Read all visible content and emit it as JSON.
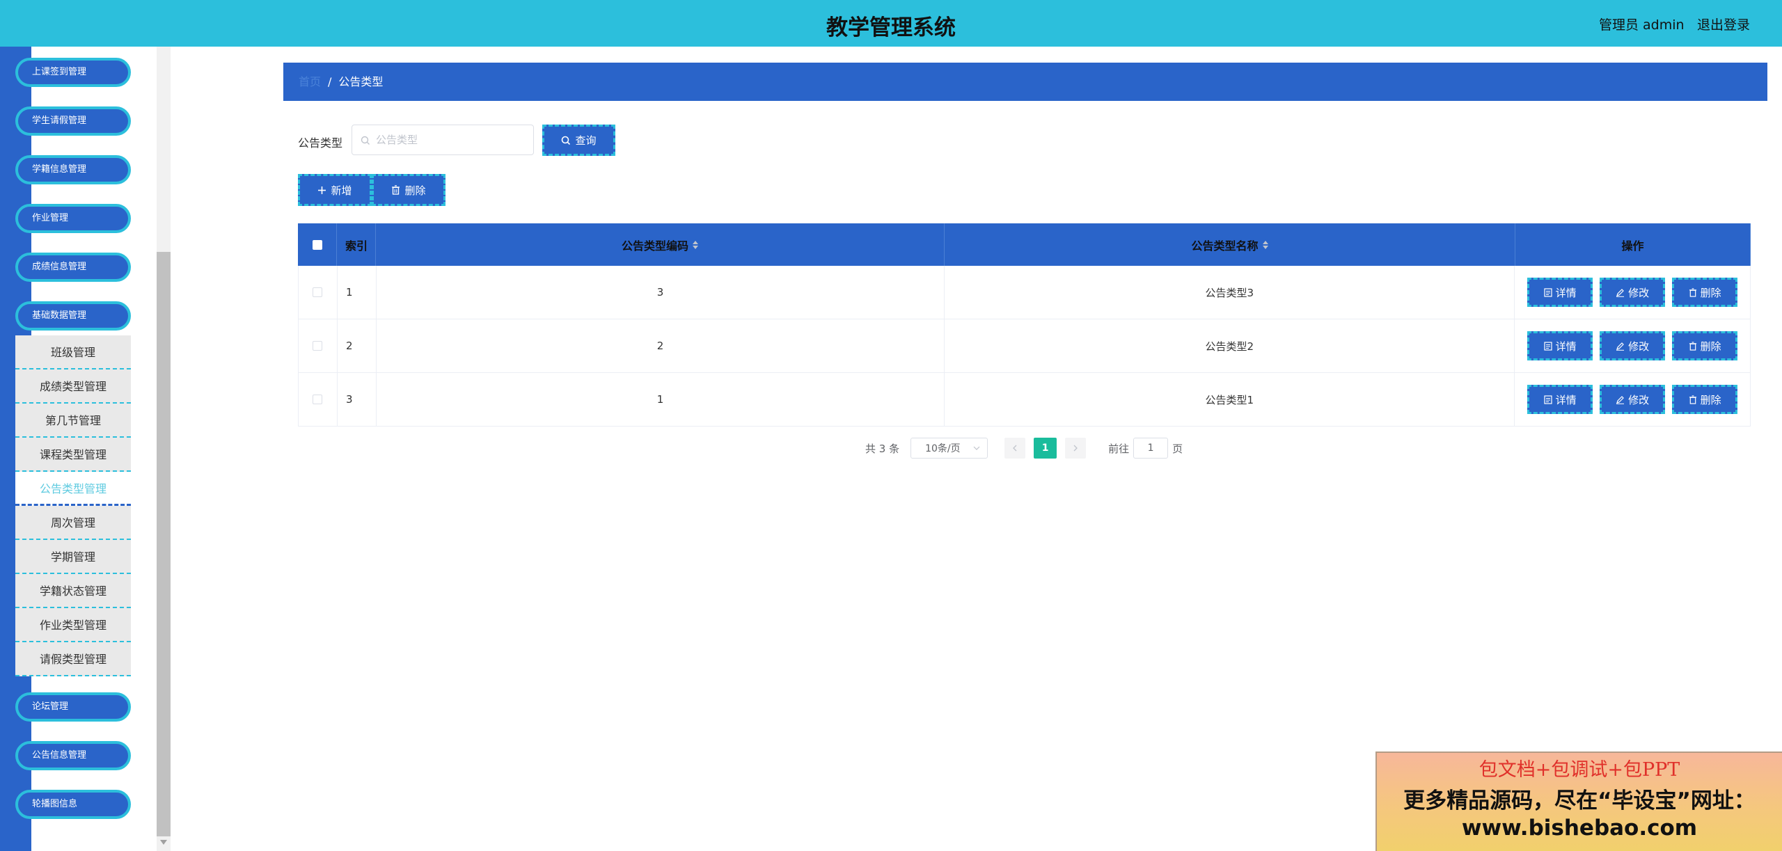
{
  "header": {
    "title": "教学管理系统",
    "user": "管理员 admin",
    "logout": "退出登录"
  },
  "sidebar": {
    "menus_top": [
      "上课签到管理",
      "学生请假管理",
      "学籍信息管理",
      "作业管理",
      "成绩信息管理",
      "基础数据管理"
    ],
    "submenu": [
      "班级管理",
      "成绩类型管理",
      "第几节管理",
      "课程类型管理",
      "公告类型管理",
      "周次管理",
      "学期管理",
      "学籍状态管理",
      "作业类型管理",
      "请假类型管理"
    ],
    "submenu_active": "公告类型管理",
    "menus_bottom": [
      "论坛管理",
      "公告信息管理",
      "轮播图信息"
    ]
  },
  "breadcrumb": {
    "home": "首页",
    "separator": "/",
    "current": "公告类型"
  },
  "search": {
    "label": "公告类型",
    "placeholder": "公告类型",
    "value": "",
    "button": "查询"
  },
  "actions": {
    "add": "新增",
    "delete": "删除"
  },
  "table": {
    "columns": [
      "索引",
      "公告类型编码",
      "公告类型名称",
      "操作"
    ],
    "rows": [
      {
        "index": "1",
        "code": "3",
        "name": "公告类型3"
      },
      {
        "index": "2",
        "code": "2",
        "name": "公告类型2"
      },
      {
        "index": "3",
        "code": "1",
        "name": "公告类型1"
      }
    ],
    "row_buttons": {
      "detail": "详情",
      "edit": "修改",
      "delete": "删除"
    }
  },
  "pagination": {
    "total": "共 3 条",
    "page_size": "10条/页",
    "current_page": "1",
    "goto_prefix": "前往",
    "goto_value": "1",
    "goto_suffix": "页"
  },
  "promo": {
    "line1": "包文档+包调试+包PPT",
    "line2": "更多精品源码，尽在“毕设宝”网址：",
    "line3": "www.bishebao.com"
  },
  "colors": {
    "header": "#2cbfdc",
    "primary": "#2a64c9",
    "accent_dashed": "#2cbfdc",
    "page_active": "#1abc9c"
  }
}
